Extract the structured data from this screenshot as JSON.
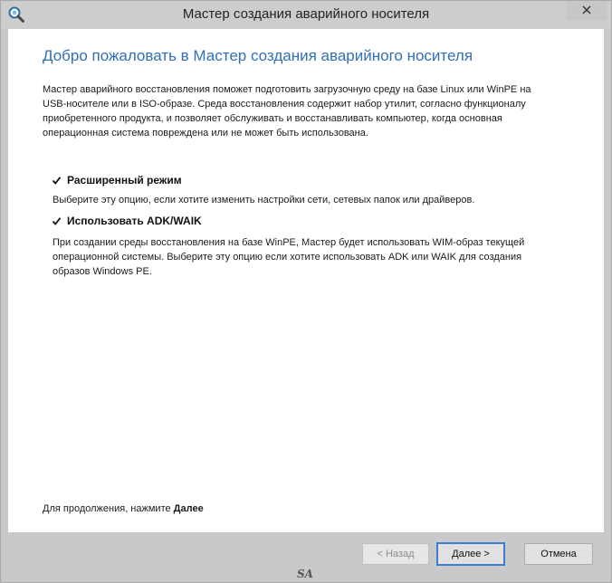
{
  "window": {
    "title": "Мастер создания аварийного носителя",
    "icon": "search-disk-icon"
  },
  "page": {
    "heading": "Добро пожаловать в Мастер создания аварийного носителя",
    "description_lines": [
      "Мастер аварийного восстановления поможет подготовить загрузочную среду на базе Linux или WinPE на",
      "USB-носителе или в ISO-образе. Среда восстановления содержит набор утилит, согласно функционалу",
      "приобретенного продукта, и позволяет обслуживать и восстанавливать компьютер, когда основная",
      "операционная система повреждена или не может быть использована."
    ]
  },
  "options": [
    {
      "label": "Расширенный режим",
      "checked": true,
      "description_lines": [
        "Выберите эту опцию, если хотите изменить настройки сети, сетевых папок или драйверов."
      ]
    },
    {
      "label": "Использовать ADK/WAIK",
      "checked": true,
      "description_lines": [
        "При создании среды восстановления на базе WinPE, Мастер будет использовать WIM-образ текущей",
        "операционной системы. Выберите эту опцию если хотите использовать ADK или WAIK для создания",
        "образов Windows PE."
      ]
    }
  ],
  "footer": {
    "note_prefix": "Для продолжения, нажмите",
    "note_bold": "Далее"
  },
  "buttons": {
    "back": "< Назад",
    "next": "Далее >",
    "cancel": "Отмена"
  },
  "watermark": "SA",
  "colors": {
    "heading": "#2f6fb7",
    "default_button_border": "#3c7fd1"
  }
}
